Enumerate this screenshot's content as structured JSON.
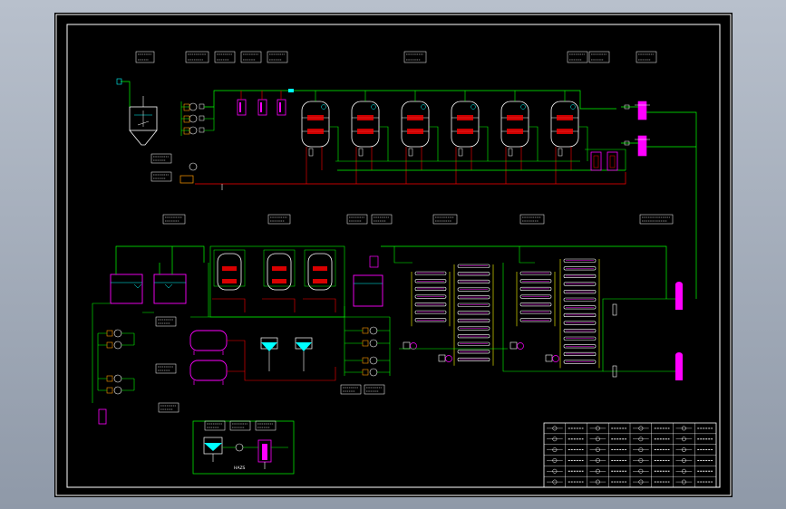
{
  "bottom_caption": "",
  "colors": {
    "background": "#000000",
    "frame": "#ffffff",
    "pipe_green": "#00ff00",
    "pipe_red": "#ff0000",
    "vessel_magenta": "#ff00ff",
    "instrument_cyan": "#00ffff",
    "tag_white": "#ffffff"
  },
  "icons": [
    "tank-icon",
    "pump-icon",
    "filter-icon",
    "membrane-icon",
    "valve-icon",
    "flowmeter-icon"
  ],
  "legend_rows": 6,
  "legend_cols": 8
}
